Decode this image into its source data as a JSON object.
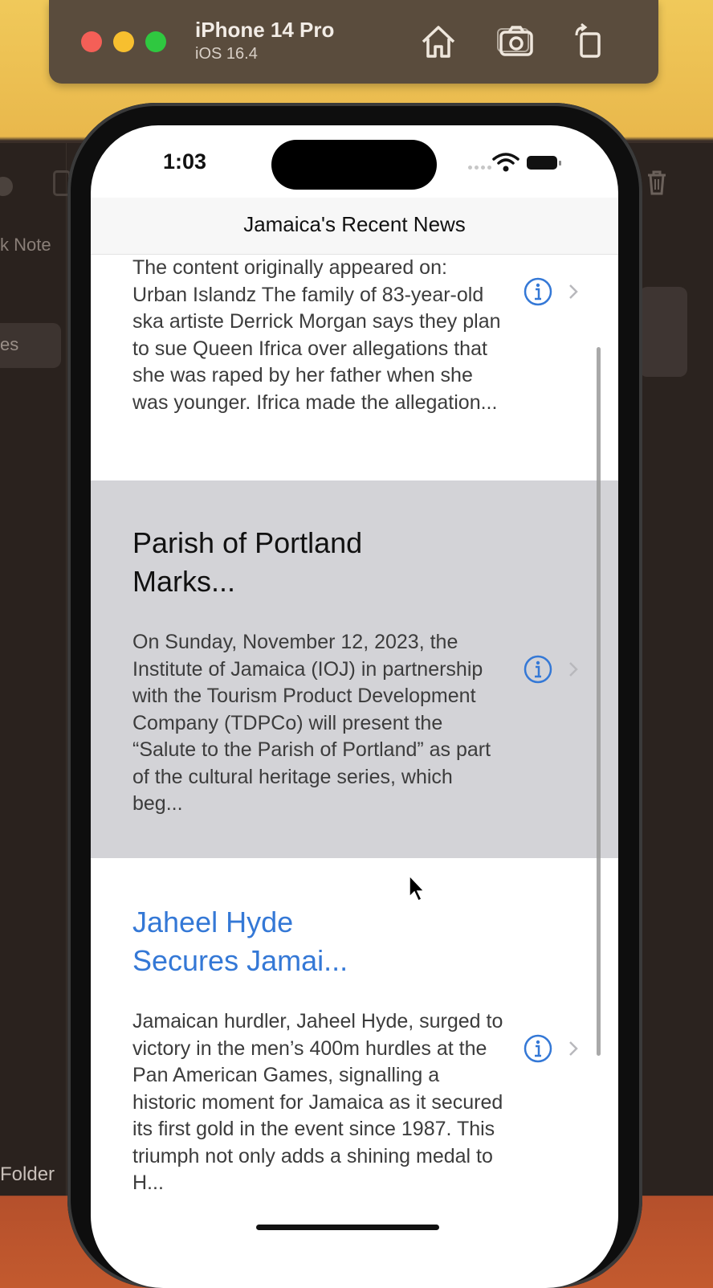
{
  "simulator": {
    "device_name": "iPhone 14 Pro",
    "os_version": "iOS 16.4"
  },
  "backdrop": {
    "sidebar_partial_label": "k Note",
    "sidebar_selected_partial": "es",
    "folder_label": "Folder"
  },
  "status_bar": {
    "time": "1:03"
  },
  "navbar": {
    "title": "Jamaica's Recent News"
  },
  "articles": [
    {
      "title": "",
      "body": "The content originally appeared on: Urban Islandz The family of 83-year-old ska artiste Derrick Morgan says they plan to sue Queen Ifrica over allegations that she was raped by her father when she was younger. Ifrica made the allegation..."
    },
    {
      "title": "Parish of Portland Marks...",
      "body": "On Sunday, November 12, 2023, the Institute of Jamaica (IOJ) in partnership with the Tourism Product Development Company (TDPCo) will present the “Salute to the Parish of Portland” as part of the cultural heritage series, which beg..."
    },
    {
      "title": "Jaheel Hyde Secures Jamai...",
      "body": "Jamaican hurdler, Jaheel Hyde, surged to victory in the men’s 400m hurdles at the Pan American Games, signalling a historic moment for Jamaica as it secured its first gold in the event since 1987. This triumph not only adds a shining medal to H..."
    }
  ],
  "colors": {
    "accent": "#3478d6",
    "selected_row": "#d3d3d7"
  }
}
